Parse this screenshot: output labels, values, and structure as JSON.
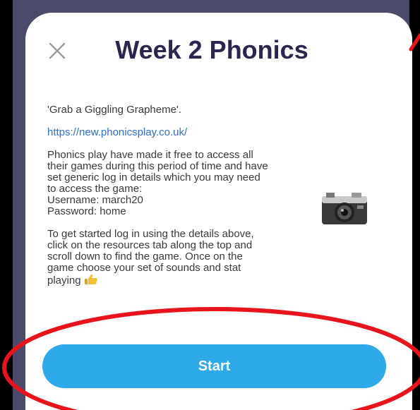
{
  "modal": {
    "title": "Week 2 Phonics",
    "close_icon": "close-icon",
    "start_label": "Start",
    "accent_color": "#2ea9ea",
    "title_color": "#2b2650",
    "link_color": "#2d6fd1"
  },
  "content": {
    "quote": "'Grab a Giggling Grapheme'.",
    "link": "https://new.phonicsplay.co.uk/",
    "body_lines": [
      "Phonics play have made it free to access all",
      "their games during this period of time and have",
      "set generic log in details which you may need",
      "to access the game:",
      "Username: march20",
      "Password: home"
    ],
    "instructions_lines": [
      "To get started log in using the details above,",
      "click on the resources tab along the top and",
      "scroll down to find the game. Once on the",
      "game choose your set of sounds and stat",
      "playing"
    ],
    "camera_icon": "camera-icon",
    "thumbs_up_icon": "thumbs-up-icon"
  },
  "annotation": {
    "color": "#e8131b"
  }
}
